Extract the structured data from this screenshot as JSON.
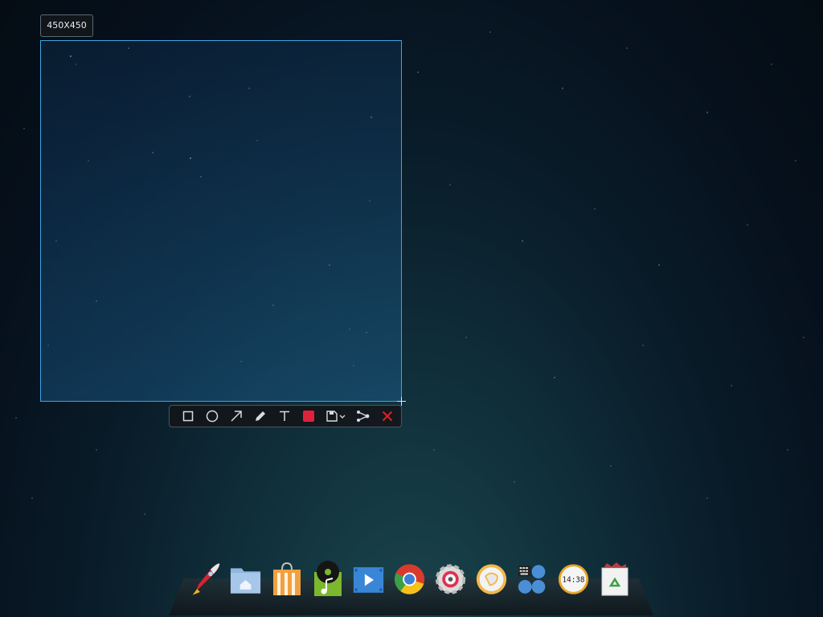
{
  "screenshot_tool": {
    "size_label": "450X450",
    "selection": {
      "width": 450,
      "height": 450
    },
    "toolbar": {
      "tools": [
        {
          "name": "rectangle-tool",
          "icon": "rectangle-icon"
        },
        {
          "name": "ellipse-tool",
          "icon": "ellipse-icon"
        },
        {
          "name": "arrow-tool",
          "icon": "arrow-icon"
        },
        {
          "name": "pen-tool",
          "icon": "pencil-icon"
        },
        {
          "name": "text-tool",
          "icon": "text-icon"
        },
        {
          "name": "color-picker",
          "icon": "color-swatch-icon",
          "color": "#e0213c"
        },
        {
          "name": "save-tool",
          "icon": "save-icon"
        },
        {
          "name": "share-tool",
          "icon": "share-icon"
        },
        {
          "name": "close-tool",
          "icon": "close-icon",
          "color": "#e02020"
        }
      ]
    }
  },
  "dock": {
    "items": [
      {
        "name": "launcher",
        "icon": "rocket-icon"
      },
      {
        "name": "file-manager",
        "icon": "home-folder-icon"
      },
      {
        "name": "app-store",
        "icon": "shopping-bag-icon"
      },
      {
        "name": "music-player",
        "icon": "music-icon"
      },
      {
        "name": "video-player",
        "icon": "video-icon"
      },
      {
        "name": "chrome",
        "icon": "chrome-icon"
      },
      {
        "name": "system-settings",
        "icon": "gear-icon"
      },
      {
        "name": "chat",
        "icon": "chat-icon"
      },
      {
        "name": "input-method",
        "icon": "keyboard-icon"
      },
      {
        "name": "clock",
        "icon": "clock-icon",
        "time": "14:38"
      },
      {
        "name": "trash",
        "icon": "trash-icon"
      }
    ]
  },
  "colors": {
    "selection_border": "#3fa3e6",
    "accent_red": "#e0213c"
  }
}
